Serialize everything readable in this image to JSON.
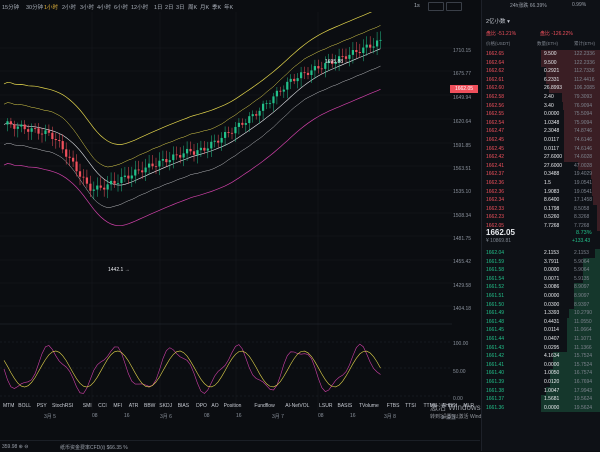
{
  "toolbar": {
    "timeframes": [
      "15分钟",
      "30分钟",
      "1小时",
      "2小时",
      "3小时",
      "4小时",
      "6小时",
      "12小时",
      "1日",
      "2日",
      "3日",
      "周K",
      "月K",
      "季K",
      "年K"
    ],
    "active_timeframe": "1小时",
    "right_controls": [
      "1s",
      "▭",
      "▢"
    ]
  },
  "price_axis": [
    "1710.15",
    "1675.77",
    "1662.05",
    "1649.94",
    "1620.64",
    "1591.85",
    "1563.51",
    "1535.10",
    "1508.34",
    "1481.75",
    "1455.42",
    "1429.58",
    "1404.18"
  ],
  "current_price_label": "1662.05",
  "annotations": {
    "high": "1695.88 →",
    "low": "1442.1 →"
  },
  "osc_axis": [
    "100.00",
    "50.00",
    "0.00"
  ],
  "time_labels": [
    "3月 5",
    "08",
    "16",
    "3月 6",
    "08",
    "16",
    "3月 7",
    "08",
    "16",
    "3月 8"
  ],
  "indicators": [
    "MTM",
    "BOLL",
    "PSY",
    "StochRSI",
    "SMI",
    "CCI",
    "MFI",
    "ATR",
    "BBW",
    "SKDJ",
    "BIAS",
    "DPO",
    "AO",
    "Position",
    "Fundflow",
    "AI-NetVOL",
    "LSUR",
    "BASIS",
    "TVolume",
    "FTBS",
    "TTSI",
    "TTMU",
    "AHBSI",
    "MLR"
  ],
  "indicator_right": "⚙ 设置",
  "bottom": {
    "left": "359.98 ⊕ ⊖",
    "mid": "纸币资金费率CFD(ℓ)  $66.35 %",
    "watermark_line1": "激活 Windows",
    "watermark_line2": "转到\"设置\"以激活 Windows。"
  },
  "orderbook": {
    "header_top": [
      "24h涨跌 66.39%",
      "0.99%",
      "2 小时  ▾"
    ],
    "period": "2亿小数 ▾",
    "stats": {
      "left": "盘比 -51.21%",
      "right": "盘比 -126.22%"
    },
    "columns": [
      "价格(USDT)",
      "数量(ETH)",
      "累计(ETH)"
    ],
    "asks": [
      [
        "1662.65",
        "9.500",
        "122.2336"
      ],
      [
        "1662.64",
        "9.500",
        "122.2336"
      ],
      [
        "1662.62",
        "0.2921",
        "112.7336"
      ],
      [
        "1662.61",
        "6.2331",
        "112.4416"
      ],
      [
        "1662.60",
        "26.8993",
        "106.2085"
      ],
      [
        "1662.58",
        "2.40",
        "79.3093"
      ],
      [
        "1662.56",
        "3.40",
        "76.9094"
      ],
      [
        "1662.55",
        "0.0000",
        "75.5094"
      ],
      [
        "1662.54",
        "1.0348",
        "75.9094"
      ],
      [
        "1662.47",
        "2.3048",
        "74.8746"
      ],
      [
        "1662.45",
        "0.0117",
        "74.6146"
      ],
      [
        "1662.45",
        "0.0117",
        "74.6146"
      ],
      [
        "1662.42",
        "27.6000",
        "74.6028"
      ],
      [
        "1662.41",
        "27.6000",
        "47.0028"
      ],
      [
        "1662.37",
        "0.3488",
        "19.4029"
      ],
      [
        "1662.36",
        "1.5",
        "19.0541"
      ],
      [
        "1662.36",
        "1.9083",
        "19.0541"
      ],
      [
        "1662.34",
        "8.6400",
        "17.1458"
      ],
      [
        "1662.33",
        "0.1798",
        "8.5058"
      ],
      [
        "1662.23",
        "0.5260",
        "8.3268"
      ],
      [
        "1662.05",
        "7.7268",
        "7.7268"
      ]
    ],
    "last_price": "1662.05",
    "last_change": "8.73%",
    "last_fiat": "¥ 10869.81",
    "last_delta": "+133.43",
    "bids": [
      [
        "1662.04",
        "2.1153",
        "2.1153"
      ],
      [
        "1661.59",
        "3.7911",
        "5.9064"
      ],
      [
        "1661.58",
        "0.0000",
        "5.9064"
      ],
      [
        "1661.54",
        "0.0071",
        "5.9135"
      ],
      [
        "1661.52",
        "3.0086",
        "8.9097"
      ],
      [
        "1661.51",
        "0.0000",
        "8.9097"
      ],
      [
        "1661.50",
        "0.0300",
        "8.9397"
      ],
      [
        "1661.49",
        "1.3393",
        "10.2790"
      ],
      [
        "1661.48",
        "0.4431",
        "11.0550"
      ],
      [
        "1661.45",
        "0.0114",
        "11.0664"
      ],
      [
        "1661.44",
        "0.0407",
        "11.1071"
      ],
      [
        "1661.43",
        "0.0295",
        "11.1366"
      ],
      [
        "1661.42",
        "4.1634",
        "15.7524"
      ],
      [
        "1661.41",
        "0.0000",
        "15.7524"
      ],
      [
        "1661.40",
        "1.0050",
        "16.7574"
      ],
      [
        "1661.39",
        "0.0120",
        "16.7694"
      ],
      [
        "1661.38",
        "1.0047",
        "17.9943"
      ],
      [
        "1661.37",
        "1.5681",
        "19.5624"
      ],
      [
        "1661.36",
        "0.0000",
        "19.5624"
      ]
    ]
  }
}
